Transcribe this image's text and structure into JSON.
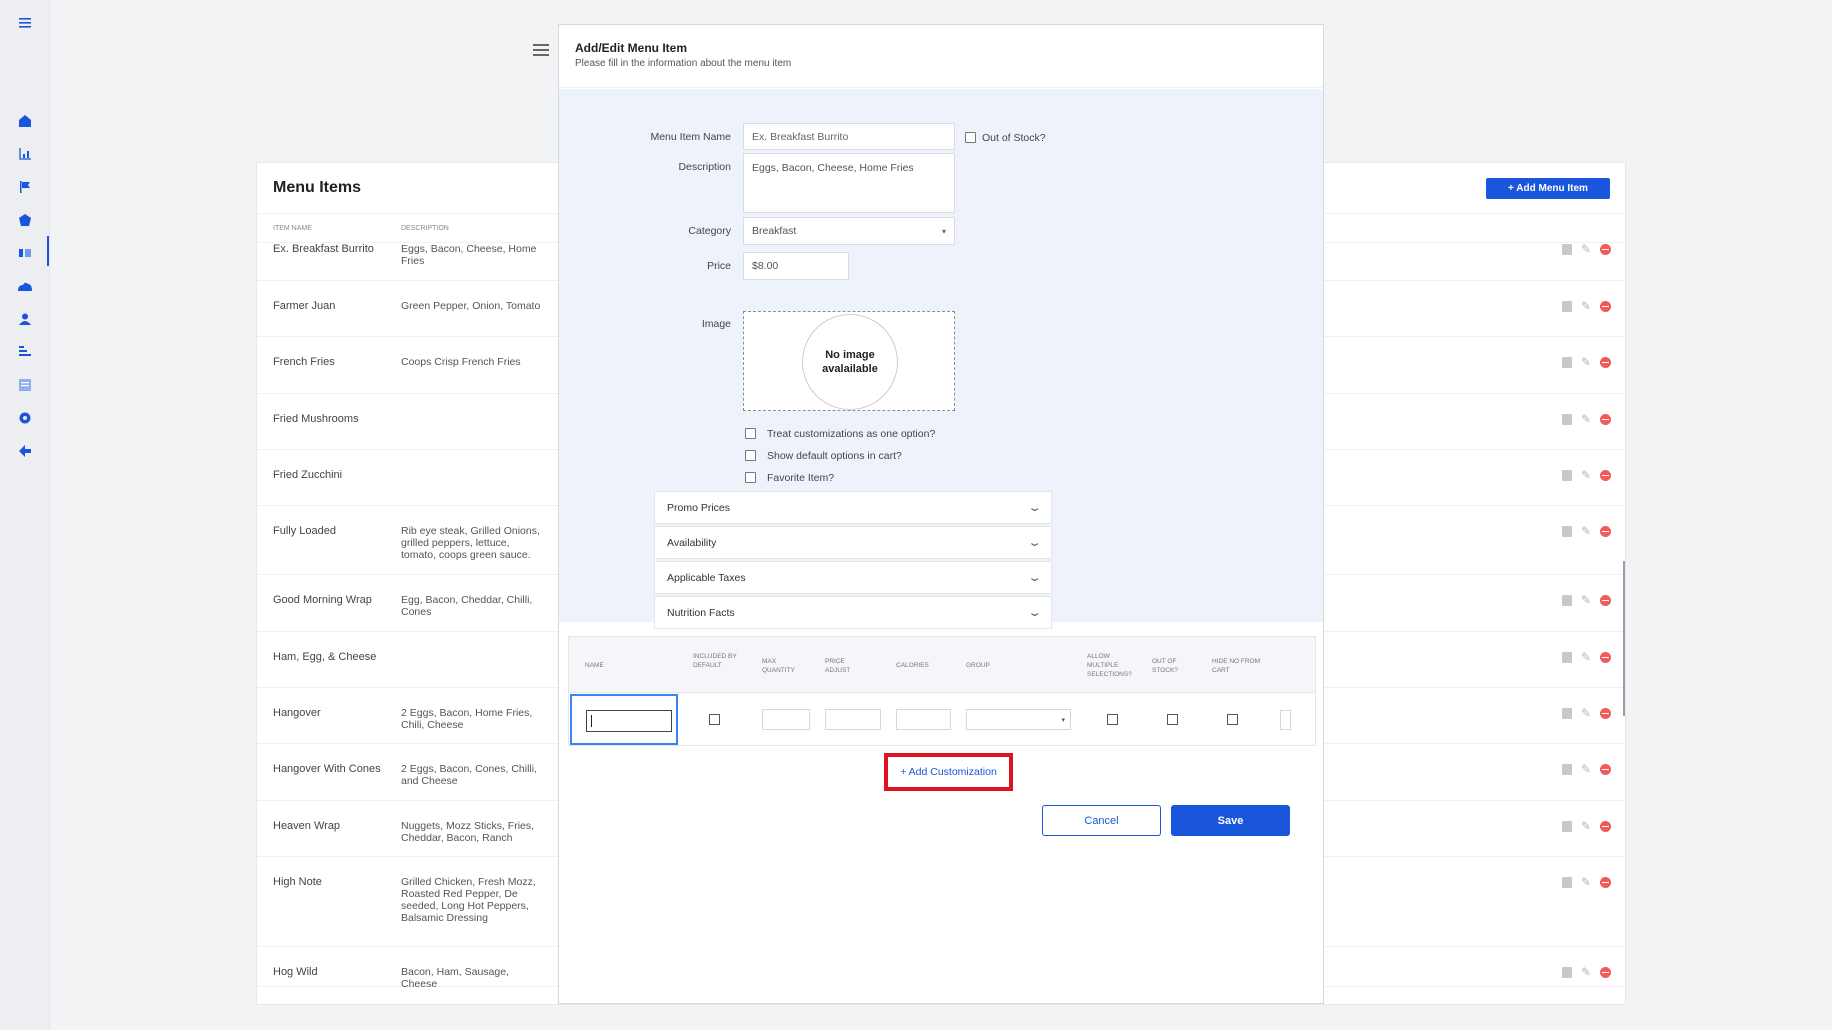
{
  "sidebar": {
    "icons": [
      "menu-icon",
      "home-icon",
      "chart-icon",
      "flag-icon",
      "tag-icon",
      "list-icon",
      "cloud-icon",
      "user-icon",
      "sort-icon",
      "grid-icon",
      "gear-icon",
      "back-arrow-icon"
    ],
    "accent_color": "#1a56db"
  },
  "menu_items": {
    "title": "Menu Items",
    "add_button": "+ Add Menu Item",
    "columns": [
      "ITEM NAME",
      "DESCRIPTION"
    ],
    "rows": [
      {
        "name": "Ex. Breakfast Burrito",
        "description": "Eggs, Bacon, Cheese, Home Fries"
      },
      {
        "name": "Farmer Juan",
        "description": "Green Pepper, Onion, Tomato"
      },
      {
        "name": "French Fries",
        "description": "Coops Crisp French Fries"
      },
      {
        "name": "Fried Mushrooms",
        "description": ""
      },
      {
        "name": "Fried Zucchini",
        "description": ""
      },
      {
        "name": "Fully Loaded",
        "description": "Rib eye steak, Grilled Onions, grilled peppers, lettuce, tomato, coops green sauce."
      },
      {
        "name": "Good Morning Wrap",
        "description": "Egg, Bacon, Cheddar, Chilli, Cones"
      },
      {
        "name": "Ham, Egg, & Cheese",
        "description": ""
      },
      {
        "name": "Hangover",
        "description": "2 Eggs, Bacon, Home Fries, Chili, Cheese"
      },
      {
        "name": "Hangover With Cones",
        "description": "2 Eggs, Bacon, Cones, Chilli, and Cheese"
      },
      {
        "name": "Heaven Wrap",
        "description": "Nuggets, Mozz Sticks, Fries, Cheddar, Bacon, Ranch"
      },
      {
        "name": "High Note",
        "description": "Grilled Chicken, Fresh Mozz, Roasted Red Pepper, De seeded, Long Hot Peppers, Balsamic Dressing"
      },
      {
        "name": "Hog Wild",
        "description": "Bacon, Ham, Sausage, Cheese"
      }
    ]
  },
  "modal": {
    "title": "Add/Edit Menu Item",
    "subtitle": "Please fill in the information about the menu item",
    "labels": {
      "name": "Menu Item Name",
      "description": "Description",
      "category": "Category",
      "price": "Price",
      "image": "Image"
    },
    "values": {
      "name_placeholder": "Ex. Breakfast Burrito",
      "description": "Eggs, Bacon, Cheese, Home Fries",
      "category": "Breakfast",
      "price": "$8.00",
      "image_placeholder": "No image avalailable"
    },
    "out_of_stock_label": "Out of Stock?",
    "checkboxes": [
      "Treat customizations as one option?",
      "Show default options in cart?",
      "Favorite Item?"
    ],
    "accordions": [
      "Promo Prices",
      "Availability",
      "Applicable Taxes",
      "Nutrition Facts"
    ],
    "customization_headers": {
      "name": "NAME",
      "included": "INCLUDED BY DEFAULT",
      "max_qty": "MAX QUANTITY",
      "price_adjust": "PRICE ADJUST",
      "calories": "CALORIES",
      "group": "GROUP",
      "allow_multiple": "ALLOW MULTIPLE SELECTIONS?",
      "out_of_stock": "OUT OF STOCK?",
      "hide_no": "HIDE NO FROM CART"
    },
    "add_customization": "+ Add Customization",
    "cancel": "Cancel",
    "save": "Save"
  }
}
